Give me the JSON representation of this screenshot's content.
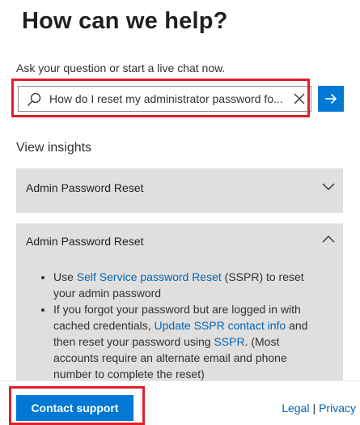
{
  "header": {
    "title": "How can we help?",
    "subtitle": "Ask your question or start a live chat now."
  },
  "search": {
    "value": "How do I reset my administrator password fo...",
    "icon": "search-icon",
    "clear_icon": "close-icon",
    "submit_icon": "arrow-right-icon"
  },
  "insights": {
    "heading": "View insights",
    "items": [
      {
        "title": "Admin Password Reset",
        "state": "collapsed",
        "icon": "chevron-down-icon"
      },
      {
        "title": "Admin Password Reset",
        "state": "expanded",
        "icon": "chevron-up-icon",
        "bullets": [
          {
            "prefix": "Use ",
            "link": "Self Service password Reset",
            "suffix": " (SSPR) to reset your admin password"
          },
          {
            "prefix": "If you forgot your password but are logged in with cached credentials, ",
            "link": "Update SSPR contact info",
            "middle": " and then reset your password using ",
            "link2": "SSPR",
            "suffix": ".  (Most accounts require an alternate email and phone number to complete the reset)"
          }
        ]
      }
    ]
  },
  "footer": {
    "contact_label": "Contact support",
    "legal_label": "Legal",
    "separator": "|",
    "privacy_label": "Privacy"
  },
  "colors": {
    "accent": "#0078d4",
    "link": "#0067b8",
    "accordion_bg": "#e1dfdd",
    "highlight": "#e0202a"
  }
}
